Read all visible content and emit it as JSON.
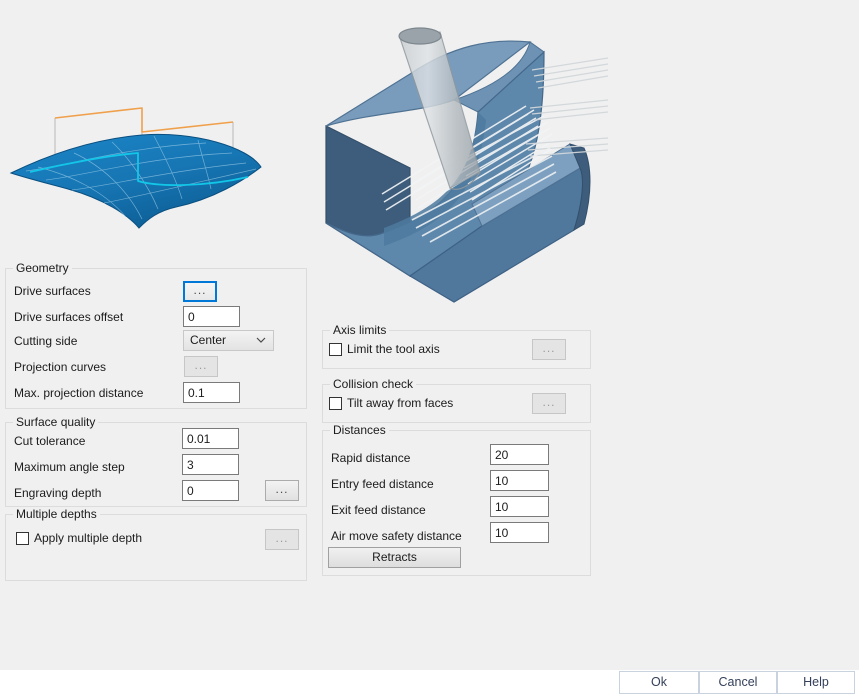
{
  "dialog": {
    "illustrations": {
      "surface_preview": "projected-curve-on-surface-illustration",
      "toolpath_preview": "tool-on-stepped-block-toolpath-illustration"
    }
  },
  "groups": {
    "geometry": {
      "title": "Geometry",
      "rows": [
        {
          "label": "Drive surfaces",
          "control": "ellipsis",
          "value": "...",
          "state": "focused"
        },
        {
          "label": "Drive surfaces offset",
          "control": "input",
          "value": "0"
        },
        {
          "label": "Cutting side",
          "control": "combo",
          "value": "Center"
        },
        {
          "label": "Projection curves",
          "control": "ellipsis",
          "value": "...",
          "state": "disabled"
        },
        {
          "label": "Max. projection distance",
          "control": "input",
          "value": "0.1"
        }
      ]
    },
    "surface_quality": {
      "title": "Surface quality",
      "rows": [
        {
          "label": "Cut tolerance",
          "control": "input",
          "value": "0.01"
        },
        {
          "label": "Maximum angle step",
          "control": "input",
          "value": "3"
        },
        {
          "label": "Engraving depth",
          "control": "input",
          "value": "0",
          "extra": "..."
        }
      ]
    },
    "multiple_depths": {
      "title": "Multiple depths",
      "checkbox_label": "Apply multiple depth",
      "checkbox_checked": false,
      "ellipsis": "..."
    },
    "axis_limits": {
      "title": "Axis limits",
      "checkbox_label": "Limit the tool axis",
      "checkbox_checked": false,
      "ellipsis": "..."
    },
    "collision_check": {
      "title": "Collision check",
      "checkbox_label": "Tilt away from faces",
      "checkbox_checked": false,
      "ellipsis": "..."
    },
    "distances": {
      "title": "Distances",
      "rows": [
        {
          "label": "Rapid distance",
          "value": "20"
        },
        {
          "label": "Entry feed distance",
          "value": "10"
        },
        {
          "label": "Exit feed distance",
          "value": "10"
        },
        {
          "label": "Air move safety distance",
          "value": "10"
        }
      ],
      "retracts_button": "Retracts"
    }
  },
  "footer": {
    "ok": "Ok",
    "cancel": "Cancel",
    "help": "Help"
  },
  "colors": {
    "background": "#f0f0f0",
    "footer_background": "#ffffff",
    "group_border": "#dcdcdc",
    "input_border": "#7a7a7a",
    "focus_accent": "#0078d7",
    "footer_button_text": "#34405a",
    "surface_blue": "#1f7fc0",
    "curve_cyan": "#00c8e6",
    "curve_orange": "#f0a04b",
    "block_blue": "#6a96b9",
    "block_blue_dark": "#3c5a78",
    "tool_gray": "#b9bfc4"
  }
}
